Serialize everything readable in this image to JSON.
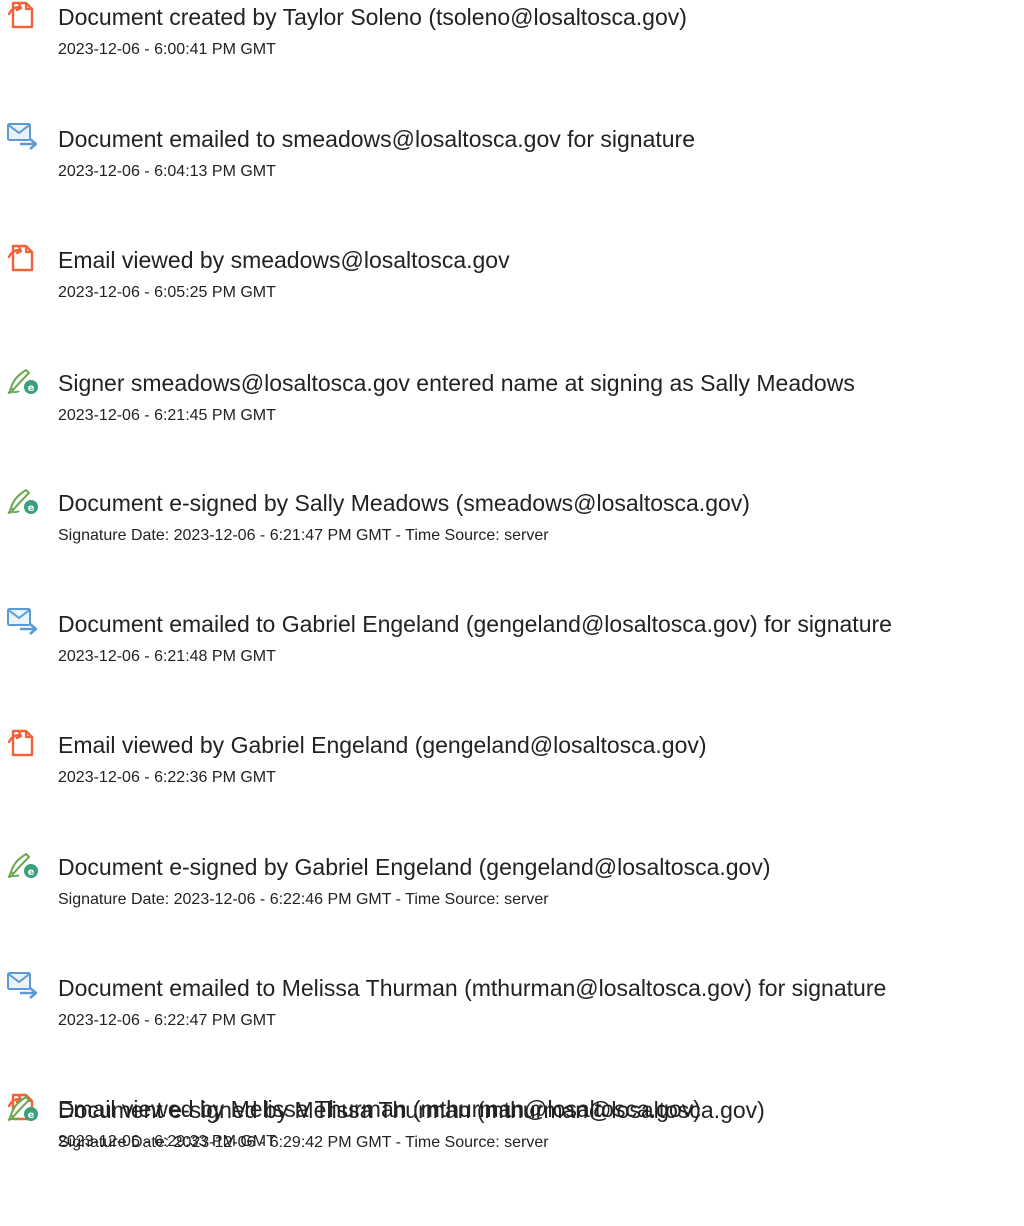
{
  "events": [
    {
      "icon": "document-created-icon",
      "title": "Document created by Taylor Soleno (tsoleno@losaltosca.gov)",
      "timestamp": "2023-12-06 - 6:00:41 PM GMT"
    },
    {
      "icon": "email-sent-icon",
      "title": "Document emailed to smeadows@losaltosca.gov for signature",
      "timestamp": "2023-12-06 - 6:04:13 PM GMT"
    },
    {
      "icon": "document-viewed-icon",
      "title": "Email viewed by smeadows@losaltosca.gov",
      "timestamp": "2023-12-06 - 6:05:25 PM GMT"
    },
    {
      "icon": "e-sign-icon",
      "title": "Signer smeadows@losaltosca.gov entered name at signing as Sally Meadows",
      "timestamp": "2023-12-06 - 6:21:45 PM GMT"
    },
    {
      "icon": "e-sign-icon",
      "title": "Document e-signed by Sally Meadows (smeadows@losaltosca.gov)",
      "timestamp": "Signature Date: 2023-12-06 - 6:21:47 PM GMT - Time Source: server"
    },
    {
      "icon": "email-sent-icon",
      "title": "Document emailed to Gabriel Engeland (gengeland@losaltosca.gov) for signature",
      "timestamp": "2023-12-06 - 6:21:48 PM GMT"
    },
    {
      "icon": "document-viewed-icon",
      "title": "Email viewed by Gabriel Engeland (gengeland@losaltosca.gov)",
      "timestamp": "2023-12-06 - 6:22:36 PM GMT"
    },
    {
      "icon": "e-sign-icon",
      "title": "Document e-signed by Gabriel Engeland (gengeland@losaltosca.gov)",
      "timestamp": "Signature Date: 2023-12-06 - 6:22:46 PM GMT - Time Source: server"
    },
    {
      "icon": "email-sent-icon",
      "title": "Document emailed to Melissa Thurman (mthurman@losaltosca.gov) for signature",
      "timestamp": "2023-12-06 - 6:22:47 PM GMT"
    },
    {
      "icon": "document-viewed-icon",
      "title": "Email viewed by Melissa Thurman (mthurman@losaltosca.gov)",
      "timestamp": "2023-12-06 - 6:29:33 PM GMT"
    },
    {
      "icon": "e-sign-icon",
      "title": "Document e-signed by Melissa Thurman (mthurman@losaltosca.gov)",
      "timestamp": "Signature Date: 2023-12-06 - 6:29:42 PM GMT - Time Source: server"
    }
  ],
  "colors": {
    "document_icon": "#f0623a",
    "email_icon": "#5b9bd5",
    "sign_icon": "#6aa84f",
    "sign_badge": "#3aa07a",
    "text": "#222222"
  }
}
